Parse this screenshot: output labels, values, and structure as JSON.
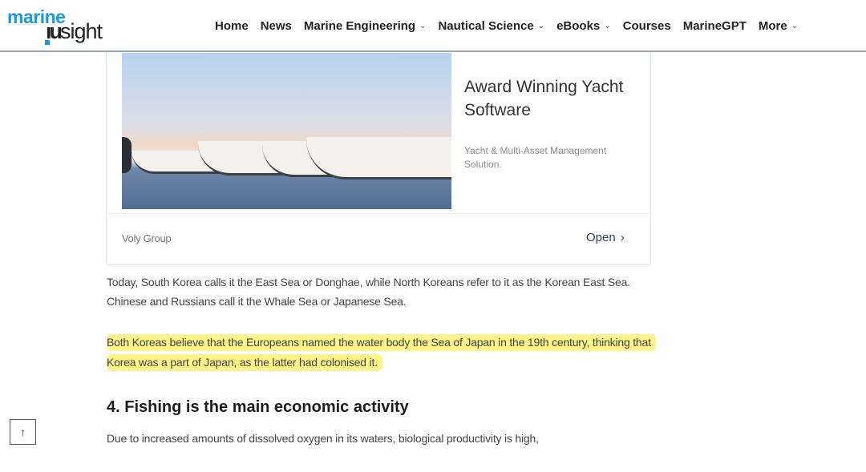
{
  "header": {
    "logo": {
      "top": "marine",
      "bottom": "sight"
    },
    "nav": [
      {
        "label": "Home",
        "has_dropdown": false
      },
      {
        "label": "News",
        "has_dropdown": false
      },
      {
        "label": "Marine Engineering",
        "has_dropdown": true
      },
      {
        "label": "Nautical Science",
        "has_dropdown": true
      },
      {
        "label": "eBooks",
        "has_dropdown": true
      },
      {
        "label": "Courses",
        "has_dropdown": false
      },
      {
        "label": "MarineGPT",
        "has_dropdown": false
      },
      {
        "label": "More",
        "has_dropdown": true
      }
    ],
    "chevron_glyph": "⌄"
  },
  "ad": {
    "title": "Award Winning Yacht Software",
    "description": "Yacht & Multi-Asset Management Solution.",
    "source": "Voly Group",
    "cta": "Open",
    "cta_icon": "›"
  },
  "article": {
    "paragraph1": "Today, South Korea calls it the East Sea or Donghae, while North Koreans refer to it as the Korean East Sea. Chinese and Russians call it the Whale Sea or Japanese Sea.",
    "paragraph2_highlighted": "Both Koreas believe that the Europeans named the water body the Sea of Japan in the 19th century, thinking that Korea was a part of Japan, as the latter had colonised it.",
    "heading": "4. Fishing is the main economic activity",
    "paragraph3": "Due to increased amounts of dissolved oxygen in its waters, biological productivity is high,"
  },
  "colors": {
    "logo_blue": "#1a9ad9",
    "highlight": "#fdf58a"
  },
  "back_to_top": {
    "icon": "↑"
  }
}
